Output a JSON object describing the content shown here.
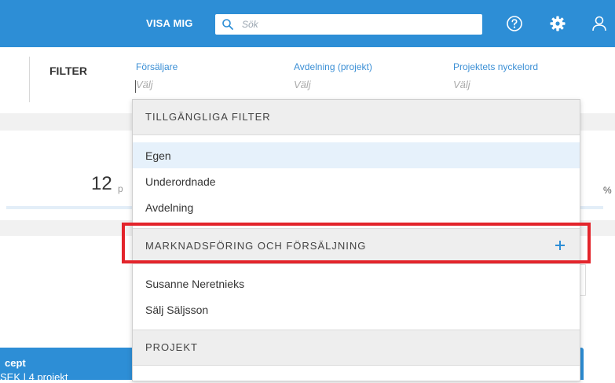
{
  "topbar": {
    "visa_mig_label": "VISA MIG",
    "search_placeholder": "Sök",
    "icons": [
      "search-icon",
      "help-icon",
      "gear-icon",
      "user-icon"
    ],
    "accent_color": "#2d8ed6"
  },
  "filterbar": {
    "label": "FILTER",
    "fields": [
      {
        "label": "Försäljare",
        "placeholder": "Välj"
      },
      {
        "label": "Avdelning (projekt)",
        "placeholder": "Välj"
      },
      {
        "label": "Projektets nyckelord",
        "placeholder": "Välj"
      }
    ]
  },
  "background": {
    "count_value": "12",
    "count_suffix": "p",
    "percent_suffix": "%",
    "card_title": "cept",
    "card_sub": "SEK   |   4 projekt"
  },
  "dropdown": {
    "sections": [
      {
        "title": "TILLGÄNGLIGA FILTER",
        "items": [
          "Egen",
          "Underordnade",
          "Avdelning"
        ],
        "selected": "Egen"
      },
      {
        "title": "MARKNADSFÖRING OCH FÖRSÄLJNING",
        "action": "plus-icon",
        "items": [
          "Susanne Neretnieks",
          "Sälj Säljsson"
        ]
      },
      {
        "title": "PROJEKT",
        "items": []
      }
    ]
  },
  "highlight_color": "#e3242b"
}
